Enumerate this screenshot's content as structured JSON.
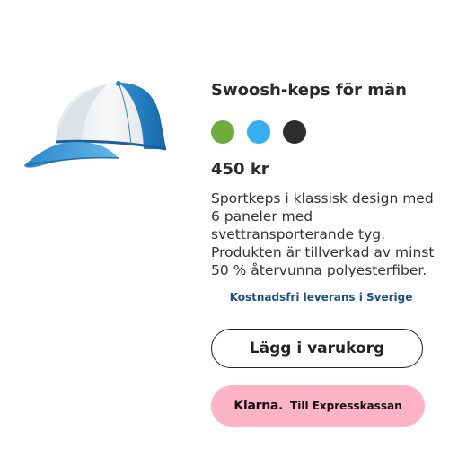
{
  "product": {
    "title": "Swoosh-keps för män",
    "image_alt": "Blå och vit keps",
    "colors": [
      {
        "name": "green",
        "hex": "#6fac3b"
      },
      {
        "name": "light-blue",
        "hex": "#36aef2"
      },
      {
        "name": "dark-gray",
        "hex": "#2e2e2e"
      }
    ],
    "price": "450 kr",
    "description": "Sportkeps i klassisk design med 6 paneler med svettransporterande tyg. Produkten är tillverkad av minst 50 % återvunna polyesterfiber.",
    "shipping_note": "Kostnadsfri leverans i Sverige"
  },
  "actions": {
    "add_to_cart_label": "Lägg i varukorg",
    "klarna_logo_text": "Klarna.",
    "klarna_label": "Till Expresskassan"
  },
  "theme": {
    "klarna_pink": "#ffb3c7",
    "shipping_link_color": "#1a4f8b"
  }
}
